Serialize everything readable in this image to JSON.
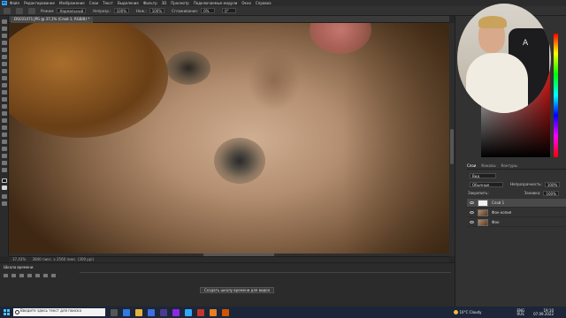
{
  "menubar": {
    "items": [
      "Файл",
      "Редактирование",
      "Изображение",
      "Слои",
      "Текст",
      "Выделение",
      "Фильтр",
      "3D",
      "Просмотр",
      "Подключаемые модули",
      "Окно",
      "Справка"
    ]
  },
  "options": {
    "style_label": "Режим:",
    "style_value": "Нормальный",
    "opacity_label": "Непрозр.:",
    "opacity_value": "100%",
    "flow_label": "Наж.:",
    "flow_value": "100%",
    "smoothing_label": "Сглаживание:",
    "smoothing_value": "0%",
    "angle_value": "0°"
  },
  "document": {
    "tab_title": "DSC01471.JPG @ 37,1% (Слой 1, RGB/8) *"
  },
  "statusbar": {
    "zoom": "37,43%",
    "info": "3840 пикс. x 2560 пикс. (300 ppi)"
  },
  "timeline": {
    "title": "Шкала времени",
    "create_button": "Создать шкалу времени для видео"
  },
  "layers": {
    "tabs": [
      "Слои",
      "Каналы",
      "Контуры"
    ],
    "filter_label": "Вид",
    "blend_mode": "Обычные",
    "opacity_label": "Непрозрачность:",
    "opacity_value": "100%",
    "lock_label": "Закрепить:",
    "fill_label": "Заливка:",
    "fill_value": "100%",
    "items": [
      {
        "name": "Слой 1",
        "selected": true
      },
      {
        "name": "Фон копия",
        "selected": false
      },
      {
        "name": "Фон",
        "selected": false
      }
    ]
  },
  "webcam": {
    "chair_logo": "A"
  },
  "taskbar": {
    "search_placeholder": "Введите здесь текст для поиска",
    "weather": "10°C  Cloudy",
    "lang_top": "ENG",
    "lang_bottom": "RUS",
    "time": "19:10",
    "date": "07.09.2022"
  }
}
